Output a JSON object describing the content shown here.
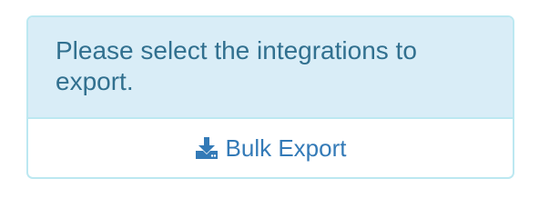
{
  "panel": {
    "message": "Please select the integrations to export.",
    "export_button": {
      "label": "Bulk Export",
      "icon": "download-icon"
    }
  },
  "colors": {
    "heading_bg": "#d9edf7",
    "heading_text": "#31708f",
    "border": "#bce8f1",
    "link": "#337ab7"
  }
}
